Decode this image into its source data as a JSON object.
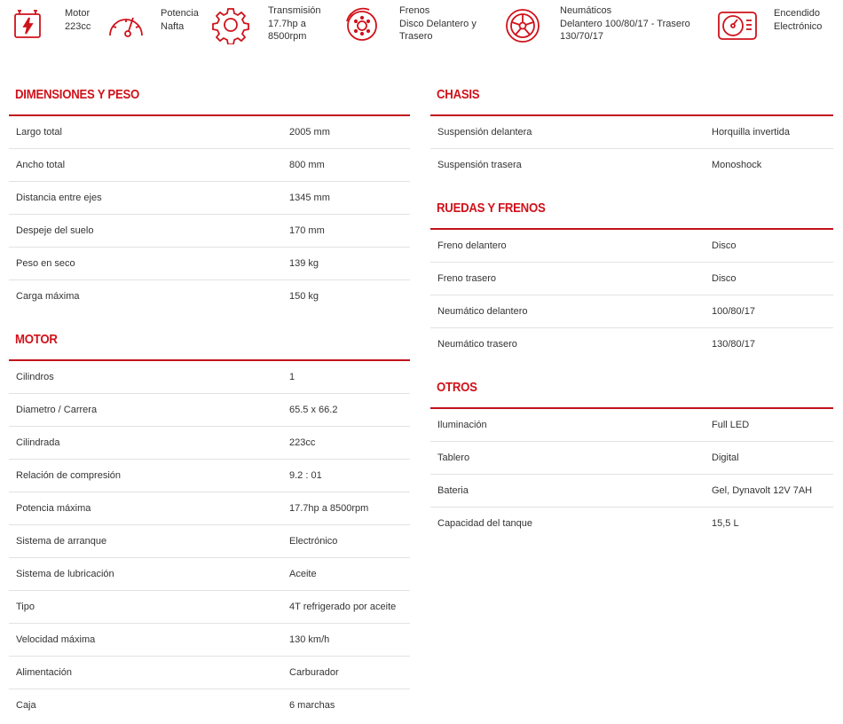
{
  "features": [
    {
      "icon": "engine-battery-icon",
      "lines": [
        "Motor",
        "223cc"
      ]
    },
    {
      "icon": "speedometer-icon",
      "lines": [
        "Potencia",
        "Nafta"
      ]
    },
    {
      "icon": "gear-icon",
      "lines": [
        "Transmisión",
        "17.7hp a",
        "8500rpm"
      ]
    },
    {
      "icon": "brake-disc-icon",
      "lines": [
        "Frenos",
        "Disco Delantero y",
        "Trasero"
      ]
    },
    {
      "icon": "wheel-icon",
      "lines": [
        "Neumáticos",
        "Delantero 100/80/17 - Trasero",
        "130/70/17"
      ]
    },
    {
      "icon": "dashboard-gauge-icon",
      "lines": [
        "Encendido",
        "Electrónico"
      ]
    }
  ],
  "left_sections": [
    {
      "title": "DIMENSIONES Y PESO",
      "rows": [
        [
          "Largo total",
          "2005 mm"
        ],
        [
          "Ancho total",
          "800 mm"
        ],
        [
          "Distancia entre ejes",
          "1345 mm"
        ],
        [
          "Despeje del suelo",
          "170 mm"
        ],
        [
          "Peso en seco",
          "139 kg"
        ],
        [
          "Carga máxima",
          "150 kg"
        ]
      ]
    },
    {
      "title": "MOTOR",
      "rows": [
        [
          "Cilindros",
          "1"
        ],
        [
          "Diametro / Carrera",
          "65.5 x 66.2"
        ],
        [
          "Cilindrada",
          "223cc"
        ],
        [
          "Relación de compresión",
          "9.2 : 01"
        ],
        [
          "Potencia máxima",
          "17.7hp a 8500rpm"
        ],
        [
          "Sistema de arranque",
          "Electrónico"
        ],
        [
          "Sistema de lubricación",
          "Aceite"
        ],
        [
          "Tipo",
          "4T refrigerado por aceite"
        ],
        [
          "Velocidad máxima",
          "130 km/h"
        ],
        [
          "Alimentación",
          "Carburador"
        ],
        [
          "Caja",
          "6 marchas"
        ]
      ]
    }
  ],
  "right_sections": [
    {
      "title": "CHASIS",
      "rows": [
        [
          "Suspensión delantera",
          "Horquilla invertida"
        ],
        [
          "Suspensión trasera",
          "Monoshock"
        ]
      ]
    },
    {
      "title": "RUEDAS Y FRENOS",
      "rows": [
        [
          "Freno delantero",
          "Disco"
        ],
        [
          "Freno trasero",
          "Disco"
        ],
        [
          "Neumático delantero",
          "100/80/17"
        ],
        [
          "Neumático trasero",
          "130/80/17"
        ]
      ]
    },
    {
      "title": "OTROS",
      "rows": [
        [
          "Iluminación",
          "Full LED"
        ],
        [
          "Tablero",
          "Digital"
        ],
        [
          "Bateria",
          "Gel, Dynavolt 12V 7AH"
        ],
        [
          "Capacidad del tanque",
          "15,5 L"
        ]
      ]
    }
  ],
  "colors": {
    "accent": "#d0121b",
    "rule": "#c1121b",
    "divider": "#e2e2e2",
    "text": "#333333"
  }
}
